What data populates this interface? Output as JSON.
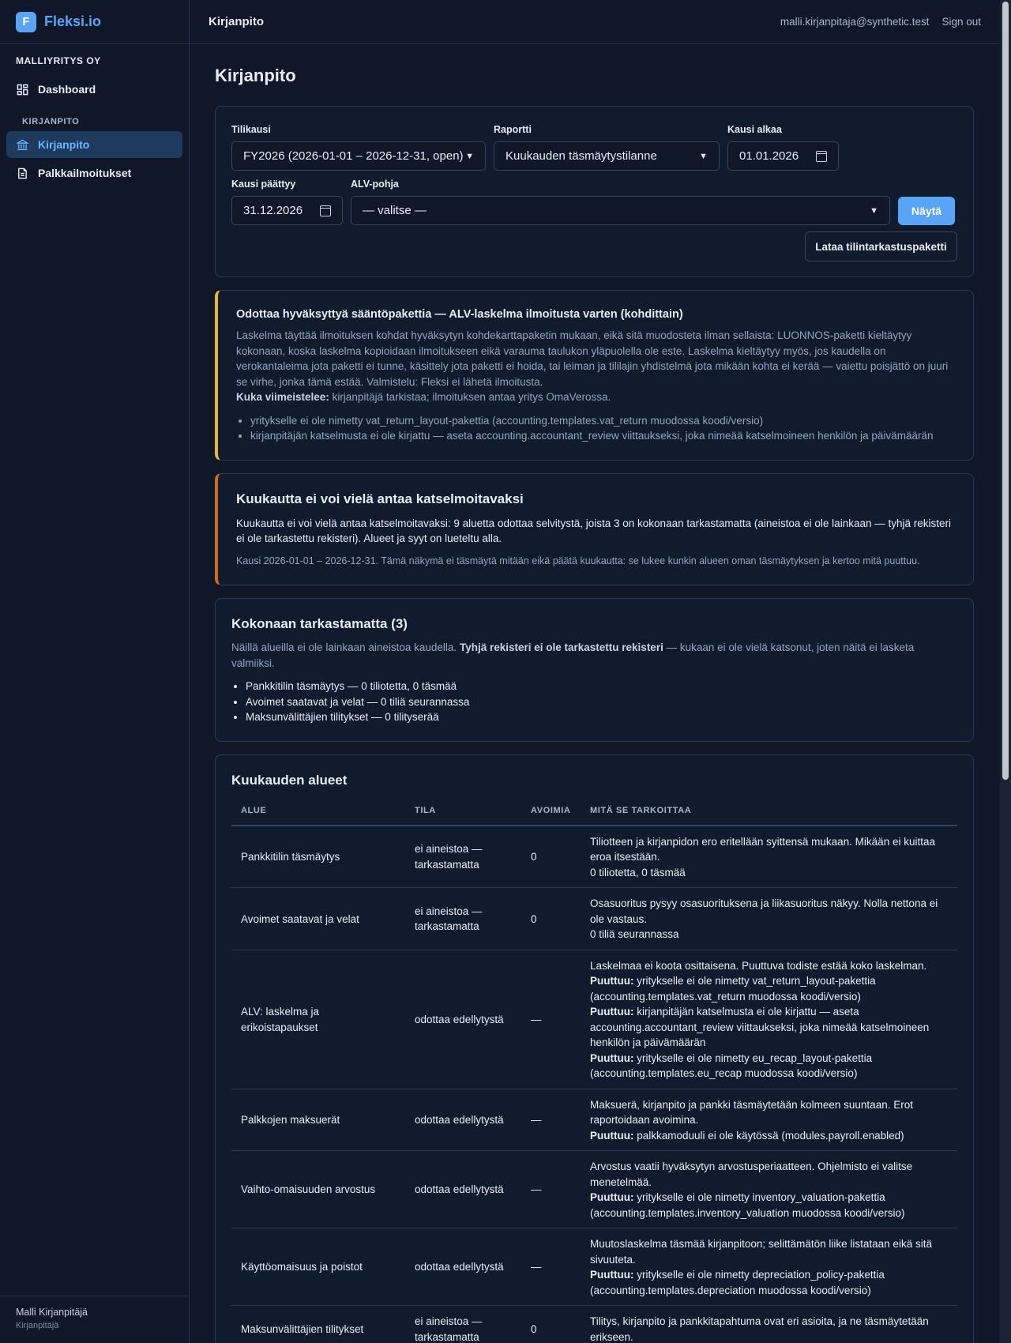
{
  "brand": {
    "mark": "F",
    "name": "Fleksi.io"
  },
  "sidebar": {
    "company": "MALLIYRITYS OY",
    "dashboard": "Dashboard",
    "section": "KIRJANPITO",
    "items": [
      {
        "label": "Kirjanpito",
        "icon": "bank-icon",
        "active": true
      },
      {
        "label": "Palkkailmoitukset",
        "icon": "document-icon",
        "active": false
      }
    ],
    "user_name": "Malli Kirjanpitäjä",
    "user_role": "Kirjanpitäjä"
  },
  "topbar": {
    "title": "Kirjanpito",
    "email": "malli.kirjanpitaja@synthetic.test",
    "signout": "Sign out"
  },
  "page": {
    "title": "Kirjanpito"
  },
  "filters": {
    "fiscal_label": "Tilikausi",
    "fiscal_value": "FY2026 (2026-01-01 – 2026-12-31, open)",
    "report_label": "Raportti",
    "report_value": "Kuukauden täsmäytystilanne",
    "start_label": "Kausi alkaa",
    "start_value": "01.01.2026",
    "end_label": "Kausi päättyy",
    "end_value": "31.12.2026",
    "vat_label": "ALV-pohja",
    "vat_value": "— valitse —",
    "show_button": "Näytä",
    "download_button": "Lataa tilintarkastuspaketti"
  },
  "notice": {
    "title": "Odottaa hyväksyttyä sääntöpakettia — ALV-laskelma ilmoitusta varten (kohdittain)",
    "body": "Laskelma täyttää ilmoituksen kohdat hyväksytyn kohdekarttapaketin mukaan, eikä sitä muodosteta ilman sellaista: LUONNOS-paketti kieltäytyy kokonaan, koska laskelma kopioidaan ilmoitukseen eikä varauma taulukon yläpuolella ole este. Laskelma kieltäytyy myös, jos kaudella on verokantaleima jota paketti ei tunne, käsittely jota paketti ei hoida, tai leiman ja tililajin yhdistelmä jota mikään kohta ei kerää — vaiettu poisjättö on juuri se virhe, jonka tämä estää. Valmistelu: Fleksi ei lähetä ilmoitusta.",
    "who_label": "Kuka viimeistelee:",
    "who_text": " kirjanpitäjä tarkistaa; ilmoituksen antaa yritys OmaVerossa.",
    "bullets": [
      "yritykselle ei ole nimetty vat_return_layout-pakettia (accounting.templates.vat_return muodossa koodi/versio)",
      "kirjanpitäjän katselmusta ei ole kirjattu — aseta accounting.accountant_review viittaukseksi, joka nimeää katselmoineen henkilön ja päivämäärän"
    ]
  },
  "alert": {
    "title": "Kuukautta ei voi vielä antaa katselmoitavaksi",
    "body": "Kuukautta ei voi vielä antaa katselmoitavaksi: 9 aluetta odottaa selvitystä, joista 3 on kokonaan tarkastamatta (aineistoa ei ole lainkaan — tyhjä rekisteri ei ole tarkastettu rekisteri). Alueet ja syyt on lueteltu alla.",
    "note": "Kausi 2026-01-01 – 2026-12-31. Tämä näkymä ei täsmäytä mitään eikä päätä kuukautta: se lukee kunkin alueen oman täsmäytyksen ja kertoo mitä puuttuu."
  },
  "unchecked": {
    "title": "Kokonaan tarkastamatta (3)",
    "intro": "Näillä alueilla ei ole lainkaan aineistoa kaudella. ",
    "intro_bold": "Tyhjä rekisteri ei ole tarkastettu rekisteri",
    "intro_end": " — kukaan ei ole vielä katsonut, joten näitä ei lasketa valmiiksi.",
    "items": [
      "Pankkitilin täsmäytys — 0 tiliotetta, 0 täsmää",
      "Avoimet saatavat ja velat — 0 tiliä seurannassa",
      "Maksunvälittäjien tilitykset — 0 tilityserää"
    ]
  },
  "areas": {
    "title": "Kuukauden alueet",
    "columns": [
      "ALUE",
      "TILA",
      "AVOIMIA",
      "MITÄ SE TARKOITTAA"
    ],
    "rows": [
      {
        "area": "Pankkitilin täsmäytys",
        "status": "ei aineistoa — tarkastamatta",
        "open": "0",
        "lines": [
          {
            "b": "",
            "t": "Tiliotteen ja kirjanpidon ero eritellään syittensä mukaan. Mikään ei kuittaa eroa itsestään."
          },
          {
            "b": "",
            "t": "0 tiliotetta, 0 täsmää"
          }
        ]
      },
      {
        "area": "Avoimet saatavat ja velat",
        "status": "ei aineistoa — tarkastamatta",
        "open": "0",
        "lines": [
          {
            "b": "",
            "t": "Osasuoritus pysyy osasuorituksena ja liikasuoritus näkyy. Nolla nettona ei ole vastaus."
          },
          {
            "b": "",
            "t": "0 tiliä seurannassa"
          }
        ]
      },
      {
        "area": "ALV: laskelma ja erikoistapaukset",
        "status": "odottaa edellytystä",
        "open": "—",
        "lines": [
          {
            "b": "",
            "t": "Laskelmaa ei koota osittaisena. Puuttuva todiste estää koko laskelman."
          },
          {
            "b": "Puuttuu:",
            "t": " yritykselle ei ole nimetty vat_return_layout-pakettia (accounting.templates.vat_return muodossa koodi/versio)"
          },
          {
            "b": "Puuttuu:",
            "t": " kirjanpitäjän katselmusta ei ole kirjattu — aseta accounting.accountant_review viittaukseksi, joka nimeää katselmoineen henkilön ja päivämäärän"
          },
          {
            "b": "Puuttuu:",
            "t": " yritykselle ei ole nimetty eu_recap_layout-pakettia (accounting.templates.eu_recap muodossa koodi/versio)"
          }
        ]
      },
      {
        "area": "Palkkojen maksuerät",
        "status": "odottaa edellytystä",
        "open": "—",
        "lines": [
          {
            "b": "",
            "t": "Maksuerä, kirjanpito ja pankki täsmäytetään kolmeen suuntaan. Erot raportoidaan avoimina."
          },
          {
            "b": "Puuttuu:",
            "t": " palkkamoduuli ei ole käytössä (modules.payroll.enabled)"
          }
        ]
      },
      {
        "area": "Vaihto-omaisuuden arvostus",
        "status": "odottaa edellytystä",
        "open": "—",
        "lines": [
          {
            "b": "",
            "t": "Arvostus vaatii hyväksytyn arvostusperiaatteen. Ohjelmisto ei valitse menetelmää."
          },
          {
            "b": "Puuttuu:",
            "t": " yritykselle ei ole nimetty inventory_valuation-pakettia (accounting.templates.inventory_valuation muodossa koodi/versio)"
          }
        ]
      },
      {
        "area": "Käyttöomaisuus ja poistot",
        "status": "odottaa edellytystä",
        "open": "—",
        "lines": [
          {
            "b": "",
            "t": "Muutoslaskelma täsmää kirjanpitoon; selittämätön liike listataan eikä sitä sivuuteta."
          },
          {
            "b": "Puuttuu:",
            "t": " yritykselle ei ole nimetty depreciation_policy-pakettia (accounting.templates.depreciation muodossa koodi/versio)"
          }
        ]
      },
      {
        "area": "Maksunvälittäjien tilitykset",
        "status": "ei aineistoa — tarkastamatta",
        "open": "0",
        "lines": [
          {
            "b": "",
            "t": "Tilitys, kirjanpito ja pankkitapahtuma ovat eri asioita, ja ne täsmäytetään erikseen."
          }
        ]
      }
    ]
  }
}
